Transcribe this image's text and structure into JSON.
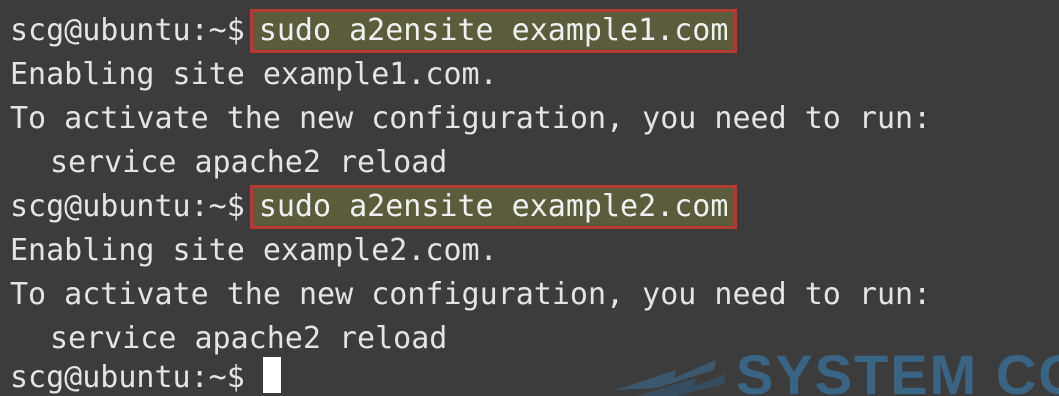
{
  "terminal": {
    "lines": [
      {
        "prompt": "scg@ubuntu:~$",
        "command": "sudo a2ensite example1.com"
      },
      {
        "output": "Enabling site example1.com."
      },
      {
        "output": "To activate the new configuration, you need to run:"
      },
      {
        "output": "service apache2 reload"
      },
      {
        "prompt": "scg@ubuntu:~$",
        "command": "sudo a2ensite example2.com"
      },
      {
        "output": "Enabling site example2.com."
      },
      {
        "output": "To activate the new configuration, you need to run:"
      },
      {
        "output": "service apache2 reload"
      },
      {
        "prompt": "scg@ubuntu:~$"
      }
    ]
  },
  "watermark": {
    "text": "SYSTEM CODE"
  },
  "colors": {
    "background": "#3c3c3c",
    "text": "#e4e4e4",
    "highlight_fill": "#5a5c3c",
    "highlight_border": "#b63a2f",
    "cursor": "#ffffff",
    "watermark": "#3a86c0"
  }
}
